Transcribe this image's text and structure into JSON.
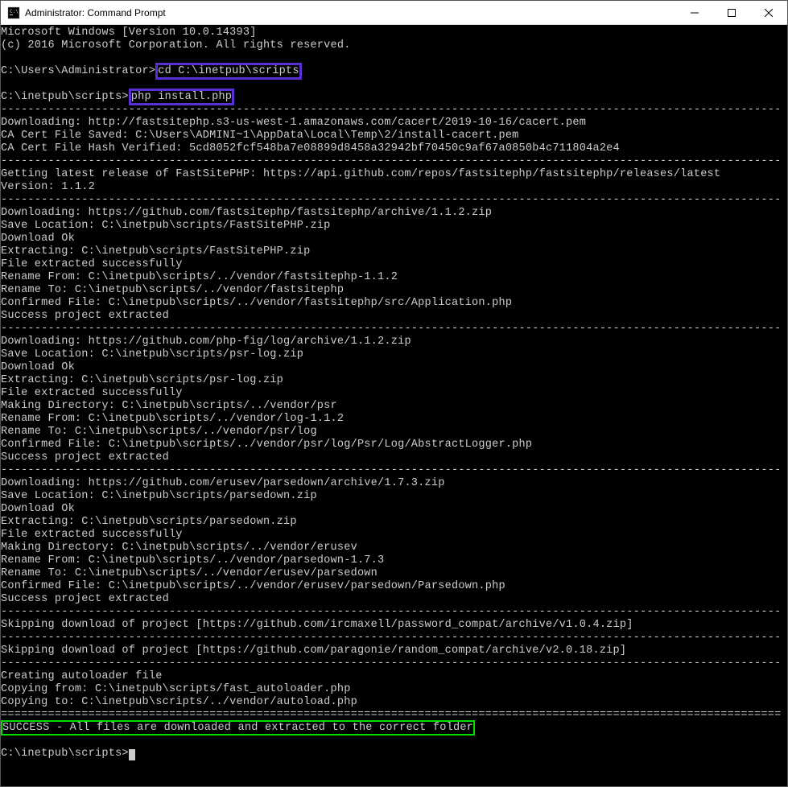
{
  "titlebar": {
    "title": "Administrator: Command Prompt"
  },
  "term": {
    "l01": "Microsoft Windows [Version 10.0.14393]",
    "l02": "(c) 2016 Microsoft Corporation. All rights reserved.",
    "l03": "",
    "prompt1_pre": "C:\\Users\\Administrator>",
    "prompt1_cmd": "cd C:\\inetpub\\scripts",
    "prompt2_pre": "C:\\inetpub\\scripts>",
    "prompt2_cmd": "php install.php",
    "sep": "--------------------------------------------------------------------------------------------------------------------",
    "l04": "Downloading: http://fastsitephp.s3-us-west-1.amazonaws.com/cacert/2019-10-16/cacert.pem",
    "l05": "CA Cert File Saved: C:\\Users\\ADMINI~1\\AppData\\Local\\Temp\\2/install-cacert.pem",
    "l06": "CA Cert File Hash Verified: 5cd8052fcf548ba7e08899d8458a32942bf70450c9af67a0850b4c711804a2e4",
    "l07": "Getting latest release of FastSitePHP: https://api.github.com/repos/fastsitephp/fastsitephp/releases/latest",
    "l08": "Version: 1.1.2",
    "l09": "Downloading: https://github.com/fastsitephp/fastsitephp/archive/1.1.2.zip",
    "l10": "Save Location: C:\\inetpub\\scripts/FastSitePHP.zip",
    "l11": "Download Ok",
    "l12": "Extracting: C:\\inetpub\\scripts/FastSitePHP.zip",
    "l13": "File extracted successfully",
    "l14": "Rename From: C:\\inetpub\\scripts/../vendor/fastsitephp-1.1.2",
    "l15": "Rename To: C:\\inetpub\\scripts/../vendor/fastsitephp",
    "l16": "Confirmed File: C:\\inetpub\\scripts/../vendor/fastsitephp/src/Application.php",
    "l17": "Success project extracted",
    "l18": "Downloading: https://github.com/php-fig/log/archive/1.1.2.zip",
    "l19": "Save Location: C:\\inetpub\\scripts/psr-log.zip",
    "l20": "Download Ok",
    "l21": "Extracting: C:\\inetpub\\scripts/psr-log.zip",
    "l22": "File extracted successfully",
    "l23": "Making Directory: C:\\inetpub\\scripts/../vendor/psr",
    "l24": "Rename From: C:\\inetpub\\scripts/../vendor/log-1.1.2",
    "l25": "Rename To: C:\\inetpub\\scripts/../vendor/psr/log",
    "l26": "Confirmed File: C:\\inetpub\\scripts/../vendor/psr/log/Psr/Log/AbstractLogger.php",
    "l27": "Success project extracted",
    "l28": "Downloading: https://github.com/erusev/parsedown/archive/1.7.3.zip",
    "l29": "Save Location: C:\\inetpub\\scripts/parsedown.zip",
    "l30": "Download Ok",
    "l31": "Extracting: C:\\inetpub\\scripts/parsedown.zip",
    "l32": "File extracted successfully",
    "l33": "Making Directory: C:\\inetpub\\scripts/../vendor/erusev",
    "l34": "Rename From: C:\\inetpub\\scripts/../vendor/parsedown-1.7.3",
    "l35": "Rename To: C:\\inetpub\\scripts/../vendor/erusev/parsedown",
    "l36": "Confirmed File: C:\\inetpub\\scripts/../vendor/erusev/parsedown/Parsedown.php",
    "l37": "Success project extracted",
    "l38": "Skipping download of project [https://github.com/ircmaxell/password_compat/archive/v1.0.4.zip]",
    "l39": "Skipping download of project [https://github.com/paragonie/random_compat/archive/v2.0.18.zip]",
    "l40": "Creating autoloader file",
    "l41": "Copying from: C:\\inetpub\\scripts/fast_autoloader.php",
    "l42": "Copying to: C:\\inetpub\\scripts/../vendor/autoload.php",
    "sep2": "====================================================================================================================",
    "success": "SUCCESS - All files are downloaded and extracted to the correct folder",
    "prompt3": "C:\\inetpub\\scripts>"
  }
}
